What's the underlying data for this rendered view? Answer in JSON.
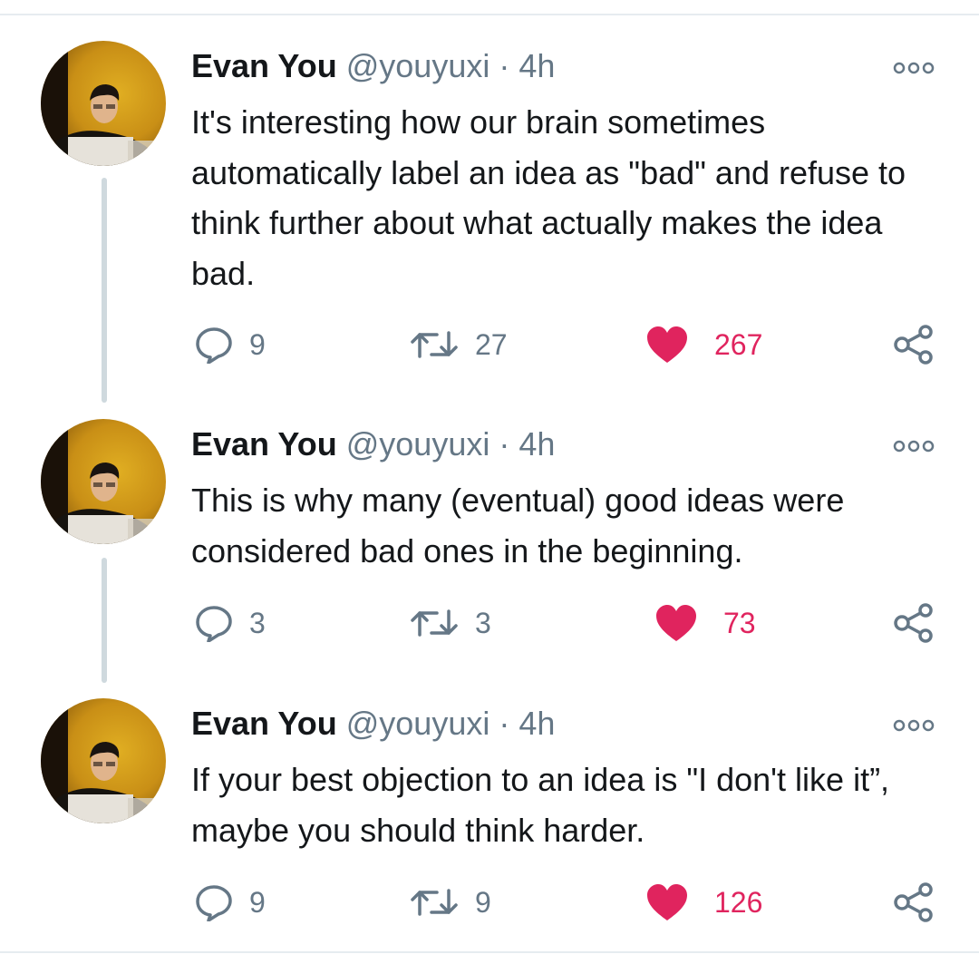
{
  "colors": {
    "text": "#14171a",
    "secondary": "#657786",
    "like": "#e0245e",
    "thread_line": "#cfd9de",
    "divider": "#e6ecf0"
  },
  "tweets": [
    {
      "name": "Evan You",
      "handle": "@youyuxi",
      "separator": "·",
      "time": "4h",
      "text": "It's interesting how our brain sometimes automatically label an idea as \"bad\" and refuse to think further about what actually makes the idea bad.",
      "replies": "9",
      "retweets": "27",
      "likes": "267",
      "liked": true
    },
    {
      "name": "Evan You",
      "handle": "@youyuxi",
      "separator": "·",
      "time": "4h",
      "text": "This is why many (eventual) good ideas were considered bad ones in the beginning.",
      "replies": "3",
      "retweets": "3",
      "likes": "73",
      "liked": true
    },
    {
      "name": "Evan You",
      "handle": "@youyuxi",
      "separator": "·",
      "time": "4h",
      "text": "If your best objection to an idea is \"I don't like it”, maybe you should think harder.",
      "replies": "9",
      "retweets": "9",
      "likes": "126",
      "liked": true
    }
  ],
  "icons": {
    "reply": "comment-bubble-icon",
    "retweet": "retweet-arrows-icon",
    "like": "heart-filled-icon",
    "share": "share-nodes-icon",
    "more": "more-dots-icon"
  }
}
